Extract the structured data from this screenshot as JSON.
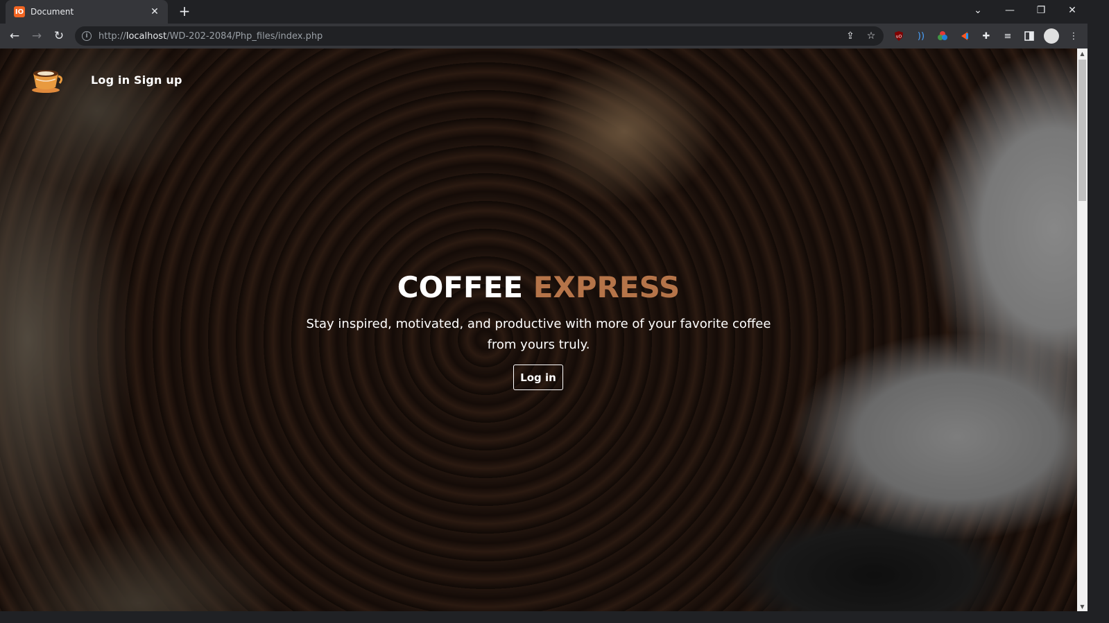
{
  "browser": {
    "tab_title": "Document",
    "tab_favicon_text": "IO",
    "new_tab_symbol": "+",
    "url_scheme": "http://",
    "url_host": "localhost",
    "url_path": "/WD-202-2084/Php_files/index.php",
    "window_controls": {
      "tab_search": "⌄",
      "minimize": "—",
      "restore": "❐",
      "close": "✕"
    },
    "nav": {
      "back": "←",
      "forward": "→",
      "reload": "↻"
    },
    "extensions": [
      "ublock-icon",
      "wave-icon",
      "color-picker-icon",
      "extension-icon",
      "puzzle-icon",
      "media-icon",
      "sidepanel-icon"
    ]
  },
  "site": {
    "nav": {
      "login": "Log in",
      "signup": "Sign up"
    },
    "hero": {
      "title_part1": "COFFEE",
      "title_part2": "EXPRESS",
      "subtitle": "Stay inspired, motivated, and productive with more of your favorite coffee from yours truly.",
      "button": "Log in"
    },
    "colors": {
      "accent": "#b57449",
      "text": "#ffffff"
    }
  }
}
